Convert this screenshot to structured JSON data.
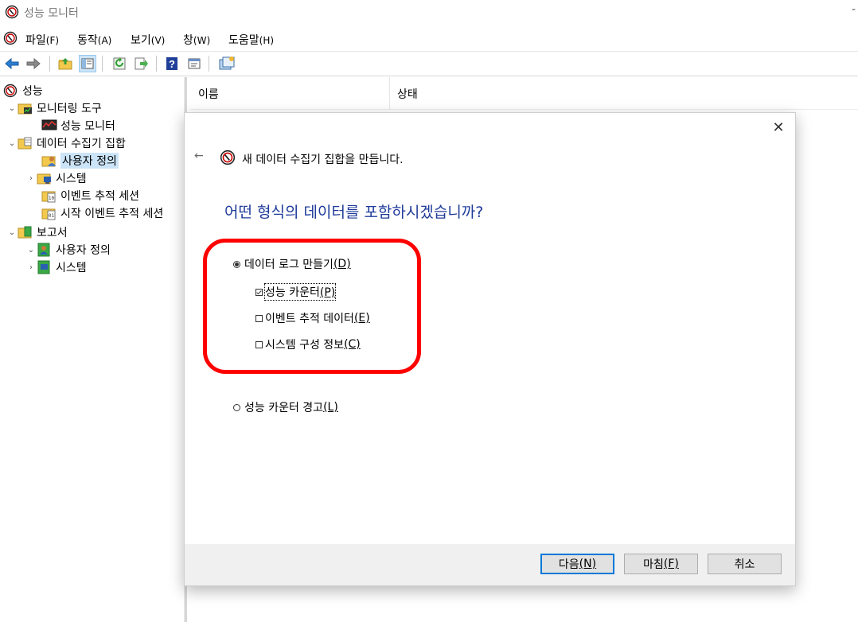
{
  "window": {
    "title": "성능 모니터",
    "minimize_glyph": "-"
  },
  "menubar": {
    "items": [
      {
        "label": "파일",
        "key": "(F)"
      },
      {
        "label": "동작",
        "key": "(A)"
      },
      {
        "label": "보기",
        "key": "(V)"
      },
      {
        "label": "창",
        "key": "(W)"
      },
      {
        "label": "도움말",
        "key": "(H)"
      }
    ]
  },
  "toolbar": {
    "icons": [
      "back-arrow-icon",
      "forward-arrow-icon",
      "up-folder-icon",
      "show-hide-tree-icon",
      "refresh-icon",
      "export-list-icon",
      "help-icon",
      "properties-icon",
      "new-window-icon"
    ]
  },
  "tree": {
    "items": [
      {
        "label": "성능",
        "icon": "perfmon-icon"
      },
      {
        "label": "모니터링 도구",
        "icon": "monitoring-tools-icon",
        "chevron": "⌄"
      },
      {
        "label": "성능 모니터",
        "icon": "performance-monitor-icon"
      },
      {
        "label": "데이터 수집기 집합",
        "icon": "data-collector-set-icon",
        "chevron": "⌄"
      },
      {
        "label": "사용자 정의",
        "icon": "user-defined-icon",
        "selected": true
      },
      {
        "label": "시스템",
        "icon": "system-icon",
        "chevron": "›"
      },
      {
        "label": "이벤트 추적 세션",
        "icon": "event-trace-icon"
      },
      {
        "label": "시작 이벤트 추적 세션",
        "icon": "startup-trace-icon"
      },
      {
        "label": "보고서",
        "icon": "reports-icon",
        "chevron": "⌄"
      },
      {
        "label": "사용자 정의",
        "icon": "user-defined-reports-icon",
        "chevron": "⌄"
      },
      {
        "label": "시스템",
        "icon": "system-reports-icon",
        "chevron": "›"
      }
    ]
  },
  "list": {
    "columns": [
      "이름",
      "상태"
    ]
  },
  "dialog": {
    "close_glyph": "✕",
    "back_glyph": "←",
    "title": "새 데이터 수집기 집합을 만듭니다.",
    "question": "어떤 형식의 데이터를 포함하시겠습니까?",
    "create_logs": {
      "label": "데이터 로그 만들기",
      "key": "(D)",
      "selected": true
    },
    "checkboxes": [
      {
        "label": "성능 카운터",
        "key": "(P)",
        "checked": true
      },
      {
        "label": "이벤트 추적 데이터",
        "key": "(E)",
        "checked": false
      },
      {
        "label": "시스템 구성 정보",
        "key": "(C)",
        "checked": false
      }
    ],
    "alert": {
      "label": "성능 카운터 경고",
      "key": "(L)",
      "selected": false
    },
    "buttons": {
      "next": {
        "label": "다음",
        "key": "(N)"
      },
      "finish": {
        "label": "마침",
        "key": "(F)"
      },
      "cancel": {
        "label": "취소"
      }
    }
  },
  "colors": {
    "highlight_ring": "#ff0000",
    "question_text": "#1f3b9a",
    "selection": "#cce4f7",
    "default_button_border": "#0078d7"
  }
}
